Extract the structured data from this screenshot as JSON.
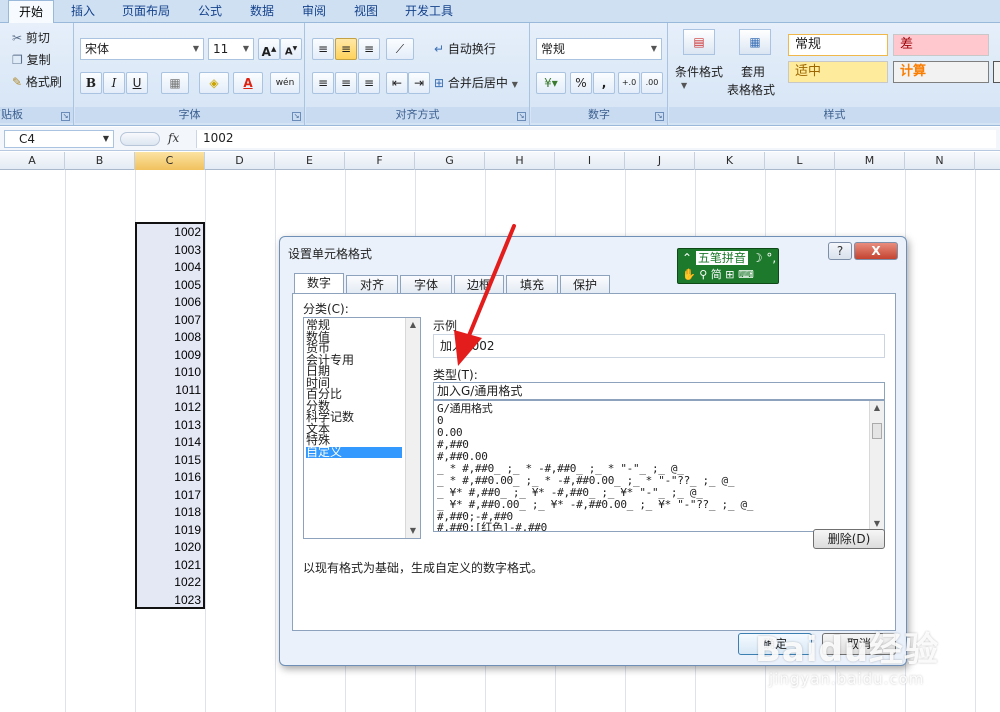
{
  "ribbon_tabs": [
    "开始",
    "插入",
    "页面布局",
    "公式",
    "数据",
    "审阅",
    "视图",
    "开发工具"
  ],
  "clipboard": {
    "cut": "剪切",
    "copy": "复制",
    "format_painter": "格式刷",
    "group": "剪贴板"
  },
  "font": {
    "name": "宋体",
    "size": "11",
    "group": "字体",
    "bold": "B",
    "italic": "I",
    "underline": "U",
    "phonetic": "wén"
  },
  "alignment": {
    "wrap_text": "自动换行",
    "merge_center": "合并后居中",
    "group": "对齐方式"
  },
  "number": {
    "format": "常规",
    "percent": "%",
    "comma": ",",
    "group": "数字",
    "inc_decimal": "+.0",
    "dec_decimal": ".00"
  },
  "styles": {
    "conditional_format": "条件格式",
    "format_as_table": "套用",
    "format_as_table2": "表格格式",
    "normal": "常规",
    "bad": "差",
    "neutral": "适中",
    "calculation": "计算",
    "group": "样式"
  },
  "formula_bar": {
    "name_box": "C4",
    "fx": "fx",
    "content": "1002"
  },
  "columns": [
    "A",
    "B",
    "C",
    "D",
    "E",
    "F",
    "G",
    "H",
    "I",
    "J",
    "K",
    "L",
    "M",
    "N"
  ],
  "cell_values": [
    "1002",
    "1003",
    "1004",
    "1005",
    "1006",
    "1007",
    "1008",
    "1009",
    "1010",
    "1011",
    "1012",
    "1013",
    "1014",
    "1015",
    "1016",
    "1017",
    "1018",
    "1019",
    "1020",
    "1021",
    "1022",
    "1023"
  ],
  "dialog": {
    "title": "设置单元格格式",
    "help": "?",
    "close": "X",
    "tabs": [
      "数字",
      "对齐",
      "字体",
      "边框",
      "填充",
      "保护"
    ],
    "category_label": "分类(C):",
    "categories": [
      "常规",
      "数值",
      "货币",
      "会计专用",
      "日期",
      "时间",
      "百分比",
      "分数",
      "科学记数",
      "文本",
      "特殊",
      "自定义"
    ],
    "selected_category": "自定义",
    "sample_label": "示例",
    "sample_value": "加入1002",
    "type_label": "类型(T):",
    "type_value": "加入G/通用格式",
    "format_list": [
      "G/通用格式",
      "0",
      "0.00",
      "#,##0",
      "#,##0.00",
      "_ * #,##0_ ;_ * -#,##0_ ;_ * \"-\"_ ;_ @_",
      "_ * #,##0.00_ ;_ * -#,##0.00_ ;_ * \"-\"??_ ;_ @_",
      "_ ¥* #,##0_ ;_ ¥* -#,##0_ ;_ ¥* \"-\"_ ;_ @_",
      "_ ¥* #,##0.00_ ;_ ¥* -#,##0.00_ ;_ ¥* \"-\"??_ ;_ @_",
      "#,##0;-#,##0",
      "#,##0;[红色]-#,##0"
    ],
    "delete": "删除(D)",
    "description": "以现有格式为基础，生成自定义的数字格式。",
    "ok": "确定",
    "cancel": "取消"
  },
  "ime": {
    "name": "五笔拼音",
    "mode": "简"
  },
  "watermark": {
    "brand": "Baidu经验",
    "url": "jingyan.baidu.com"
  },
  "colors": {
    "accent_arrow": "#e31c1c",
    "selected_category": "#3399ff",
    "ime_bg": "#1d7a2c"
  }
}
